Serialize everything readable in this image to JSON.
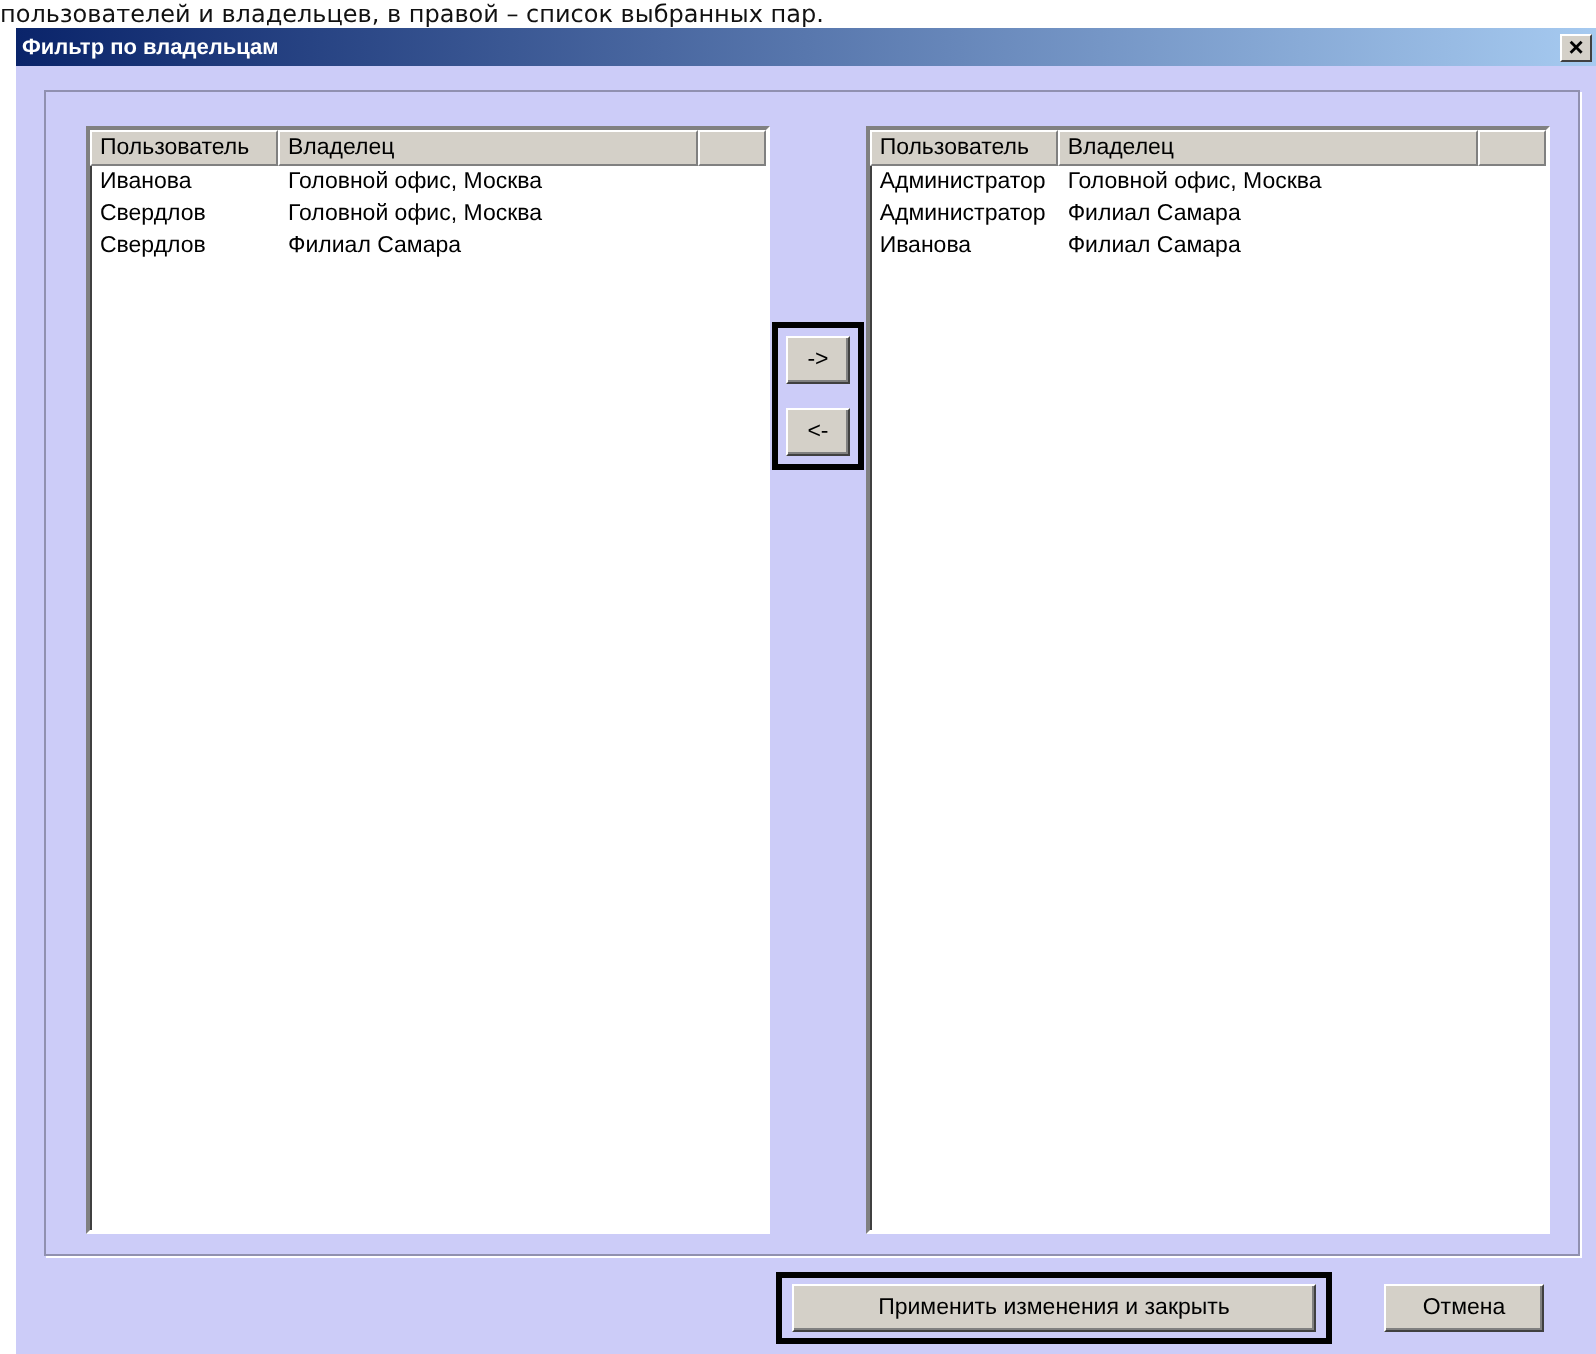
{
  "caption": "пользователей и владельцев, в правой – список выбранных пар.",
  "window": {
    "title": "Фильтр по владельцам",
    "close": "×"
  },
  "available_list": {
    "columns": [
      "Пользователь",
      "Владелец"
    ],
    "rows": [
      [
        "Иванова",
        "Головной офис, Москва"
      ],
      [
        "Свердлов",
        "Головной офис, Москва"
      ],
      [
        "Свердлов",
        "Филиал Самара"
      ]
    ]
  },
  "move_buttons": {
    "highlighted": true,
    "labels": [
      "->",
      "<-"
    ]
  },
  "selected_list": {
    "columns": [
      "Пользователь",
      "Владелец"
    ],
    "rows": [
      [
        "Администратор",
        "Головной офис, Москва"
      ],
      [
        "Администратор",
        "Филиал Самара"
      ],
      [
        "Иванова",
        "Филиал Самара"
      ]
    ]
  },
  "buttons": [
    {
      "label": "Применить изменения и закрыть",
      "highlighted": true
    },
    {
      "label": "Отмена",
      "highlighted": false
    }
  ]
}
